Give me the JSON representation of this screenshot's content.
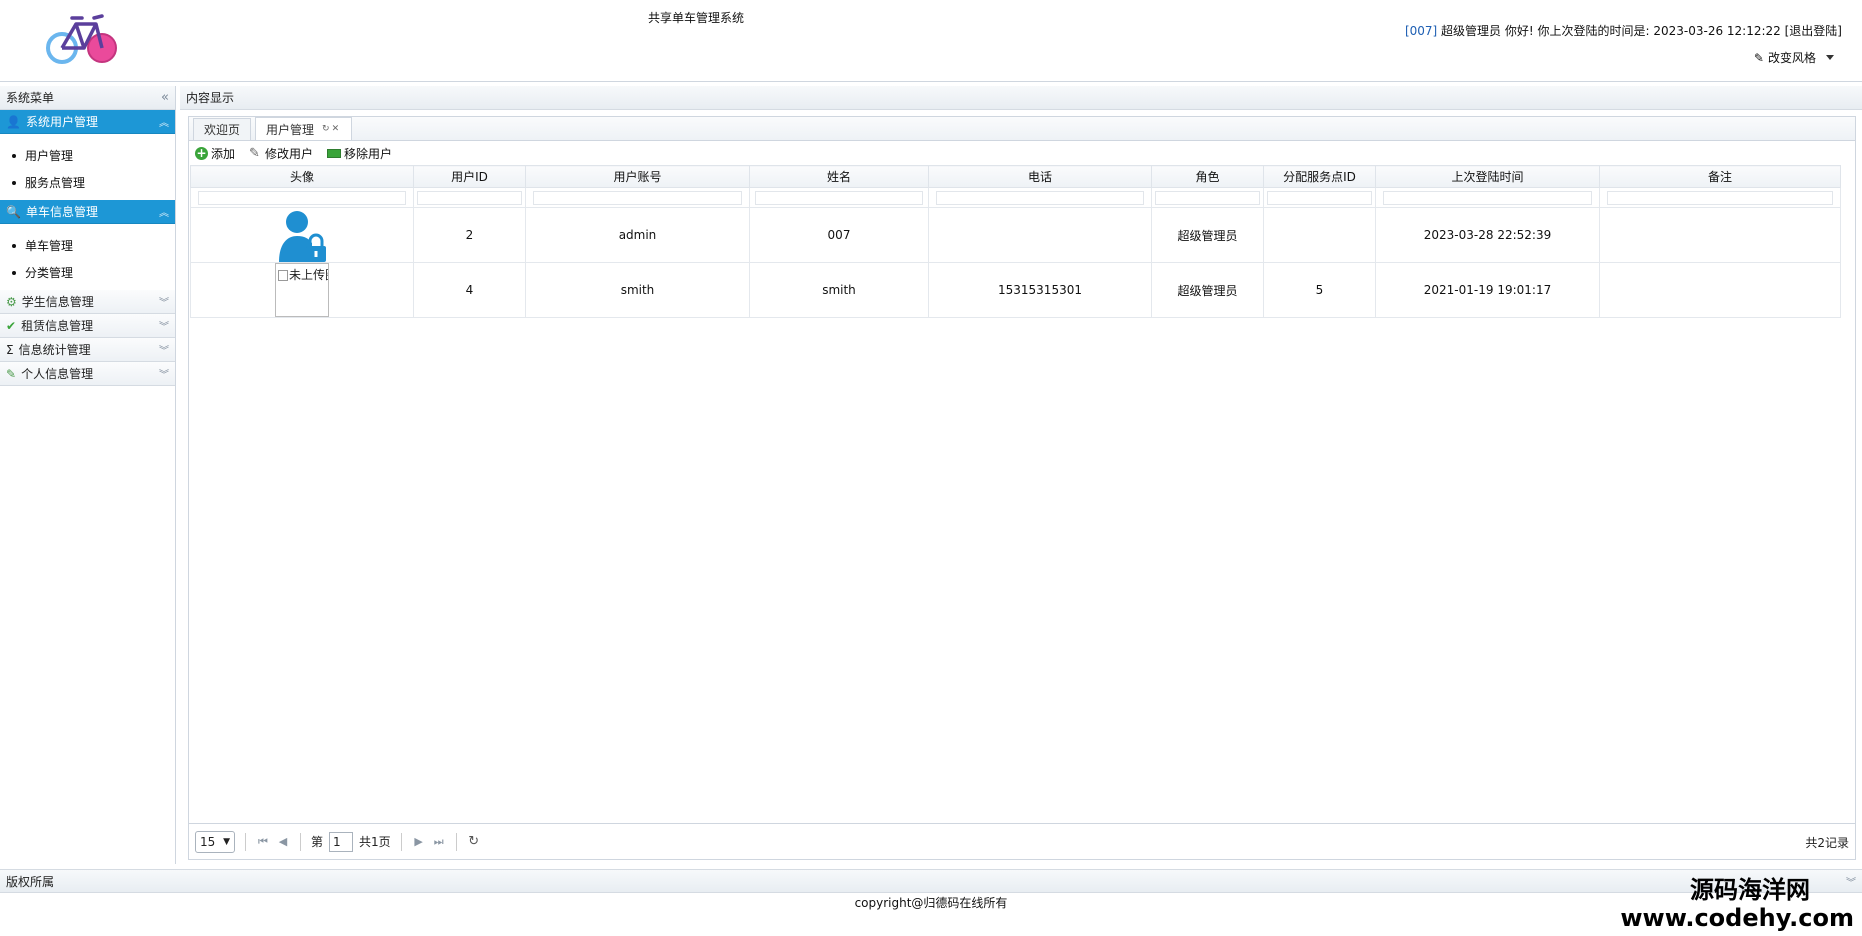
{
  "header": {
    "title": "共享单车管理系统",
    "user_id": "[007]",
    "user_greeting": "超级管理员 你好! 你上次登陆的时间是: 2023-03-26 12:12:22",
    "logout": "[退出登陆]",
    "style_switch": "改变风格"
  },
  "sidebar": {
    "title": "系统菜单",
    "groups": [
      {
        "label": "系统用户管理",
        "items": [
          "用户管理",
          "服务点管理"
        ]
      },
      {
        "label": "单车信息管理",
        "items": [
          "单车管理",
          "分类管理"
        ]
      },
      {
        "label": "学生信息管理"
      },
      {
        "label": "租赁信息管理"
      },
      {
        "label": "信息统计管理"
      },
      {
        "label": "个人信息管理"
      }
    ]
  },
  "main": {
    "title": "内容显示",
    "tabs": [
      "欢迎页",
      "用户管理"
    ],
    "toolbar": {
      "add": "添加",
      "edit": "修改用户",
      "remove": "移除用户"
    },
    "columns": [
      "头像",
      "用户ID",
      "用户账号",
      "姓名",
      "电话",
      "角色",
      "分配服务点ID",
      "上次登陆时间",
      "备注"
    ],
    "rows": [
      {
        "id": "2",
        "account": "admin",
        "name": "007",
        "phone": "",
        "role": "超级管理员",
        "service_point": "",
        "last_login": "2023-03-28 22:52:39",
        "remark": ""
      },
      {
        "id": "4",
        "account": "smith",
        "name": "smith",
        "phone": "15315315301",
        "role": "超级管理员",
        "service_point": "5",
        "last_login": "2021-01-19 19:01:17",
        "remark": "",
        "avatar_alt": "未上传图"
      }
    ],
    "pager": {
      "page_size": "15",
      "page_prefix": "第",
      "page": "1",
      "page_total": "共1页",
      "total_records": "共2记录"
    }
  },
  "footer": {
    "title": "版权所属",
    "copyright": "copyright@归德码在线所有"
  },
  "watermark": {
    "line1": "源码海洋网",
    "line2": "www.codehy.com"
  },
  "colors": {
    "accent": "#1d97d6",
    "border": "#cfd6df"
  }
}
